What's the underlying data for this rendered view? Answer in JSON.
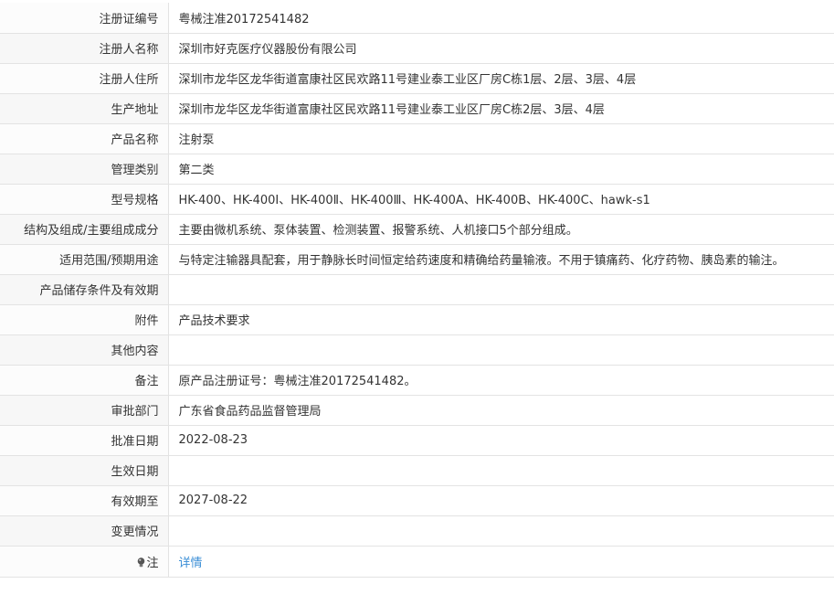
{
  "rows": [
    {
      "label": "注册证编号",
      "value": "粤械注准20172541482"
    },
    {
      "label": "注册人名称",
      "value": "深圳市好克医疗仪器股份有限公司"
    },
    {
      "label": "注册人住所",
      "value": "深圳市龙华区龙华街道富康社区民欢路11号建业泰工业区厂房C栋1层、2层、3层、4层"
    },
    {
      "label": "生产地址",
      "value": "深圳市龙华区龙华街道富康社区民欢路11号建业泰工业区厂房C栋2层、3层、4层"
    },
    {
      "label": "产品名称",
      "value": "注射泵"
    },
    {
      "label": "管理类别",
      "value": "第二类"
    },
    {
      "label": "型号规格",
      "value": "HK-400、HK-400Ⅰ、HK-400Ⅱ、HK-400Ⅲ、HK-400A、HK-400B、HK-400C、hawk-s1"
    },
    {
      "label": "结构及组成/主要组成成分",
      "value": "主要由微机系统、泵体装置、检测装置、报警系统、人机接口5个部分组成。"
    },
    {
      "label": "适用范围/预期用途",
      "value": "与特定注输器具配套，用于静脉长时间恒定给药速度和精确给药量输液。不用于镇痛药、化疗药物、胰岛素的输注。"
    },
    {
      "label": "产品储存条件及有效期",
      "value": ""
    },
    {
      "label": "附件",
      "value": "产品技术要求"
    },
    {
      "label": "其他内容",
      "value": ""
    },
    {
      "label": "备注",
      "value": "原产品注册证号：粤械注准20172541482。"
    },
    {
      "label": "审批部门",
      "value": "广东省食品药品监督管理局"
    },
    {
      "label": "批准日期",
      "value": "2022-08-23"
    },
    {
      "label": "生效日期",
      "value": ""
    },
    {
      "label": "有效期至",
      "value": "2027-08-22"
    },
    {
      "label": "变更情况",
      "value": ""
    }
  ],
  "note": {
    "label": "注",
    "icon": "lightbulb-icon",
    "link_text": "详情"
  },
  "colors": {
    "link": "#3a8ed6",
    "label_bg": "#f7f7f7",
    "border": "#e3e3e3"
  }
}
